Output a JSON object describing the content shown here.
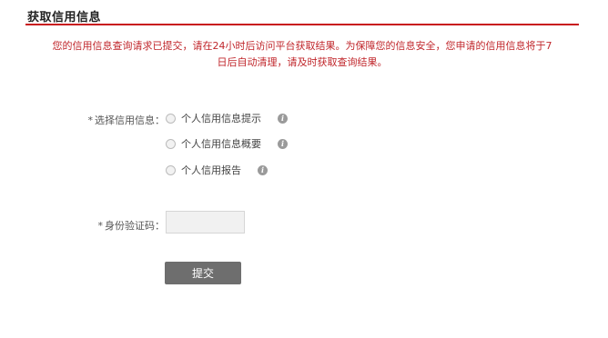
{
  "header": {
    "title": "获取信用信息"
  },
  "notice": {
    "line1": "您的信用信息查询请求已提交，请在24小时后访问平台获取结果。为保障您的信息安全，您申请的信用信息将于7",
    "line2": "日后自动清理，请及时获取查询结果。"
  },
  "form": {
    "credit_label": "选择信用信息：",
    "required_mark": "*",
    "options": [
      {
        "label": "个人信用信息提示",
        "selected": false,
        "info_icon": "info-icon"
      },
      {
        "label": "个人信用信息概要",
        "selected": false,
        "info_icon": "info-icon"
      },
      {
        "label": "个人信用报告",
        "selected": false,
        "info_icon": "info-icon"
      }
    ],
    "code_label": "身份验证码：",
    "code_value": "",
    "submit_label": "提交"
  },
  "colors": {
    "accent": "#c8161d",
    "notice_text": "#c0262b",
    "button_bg": "#6e6e6e"
  }
}
